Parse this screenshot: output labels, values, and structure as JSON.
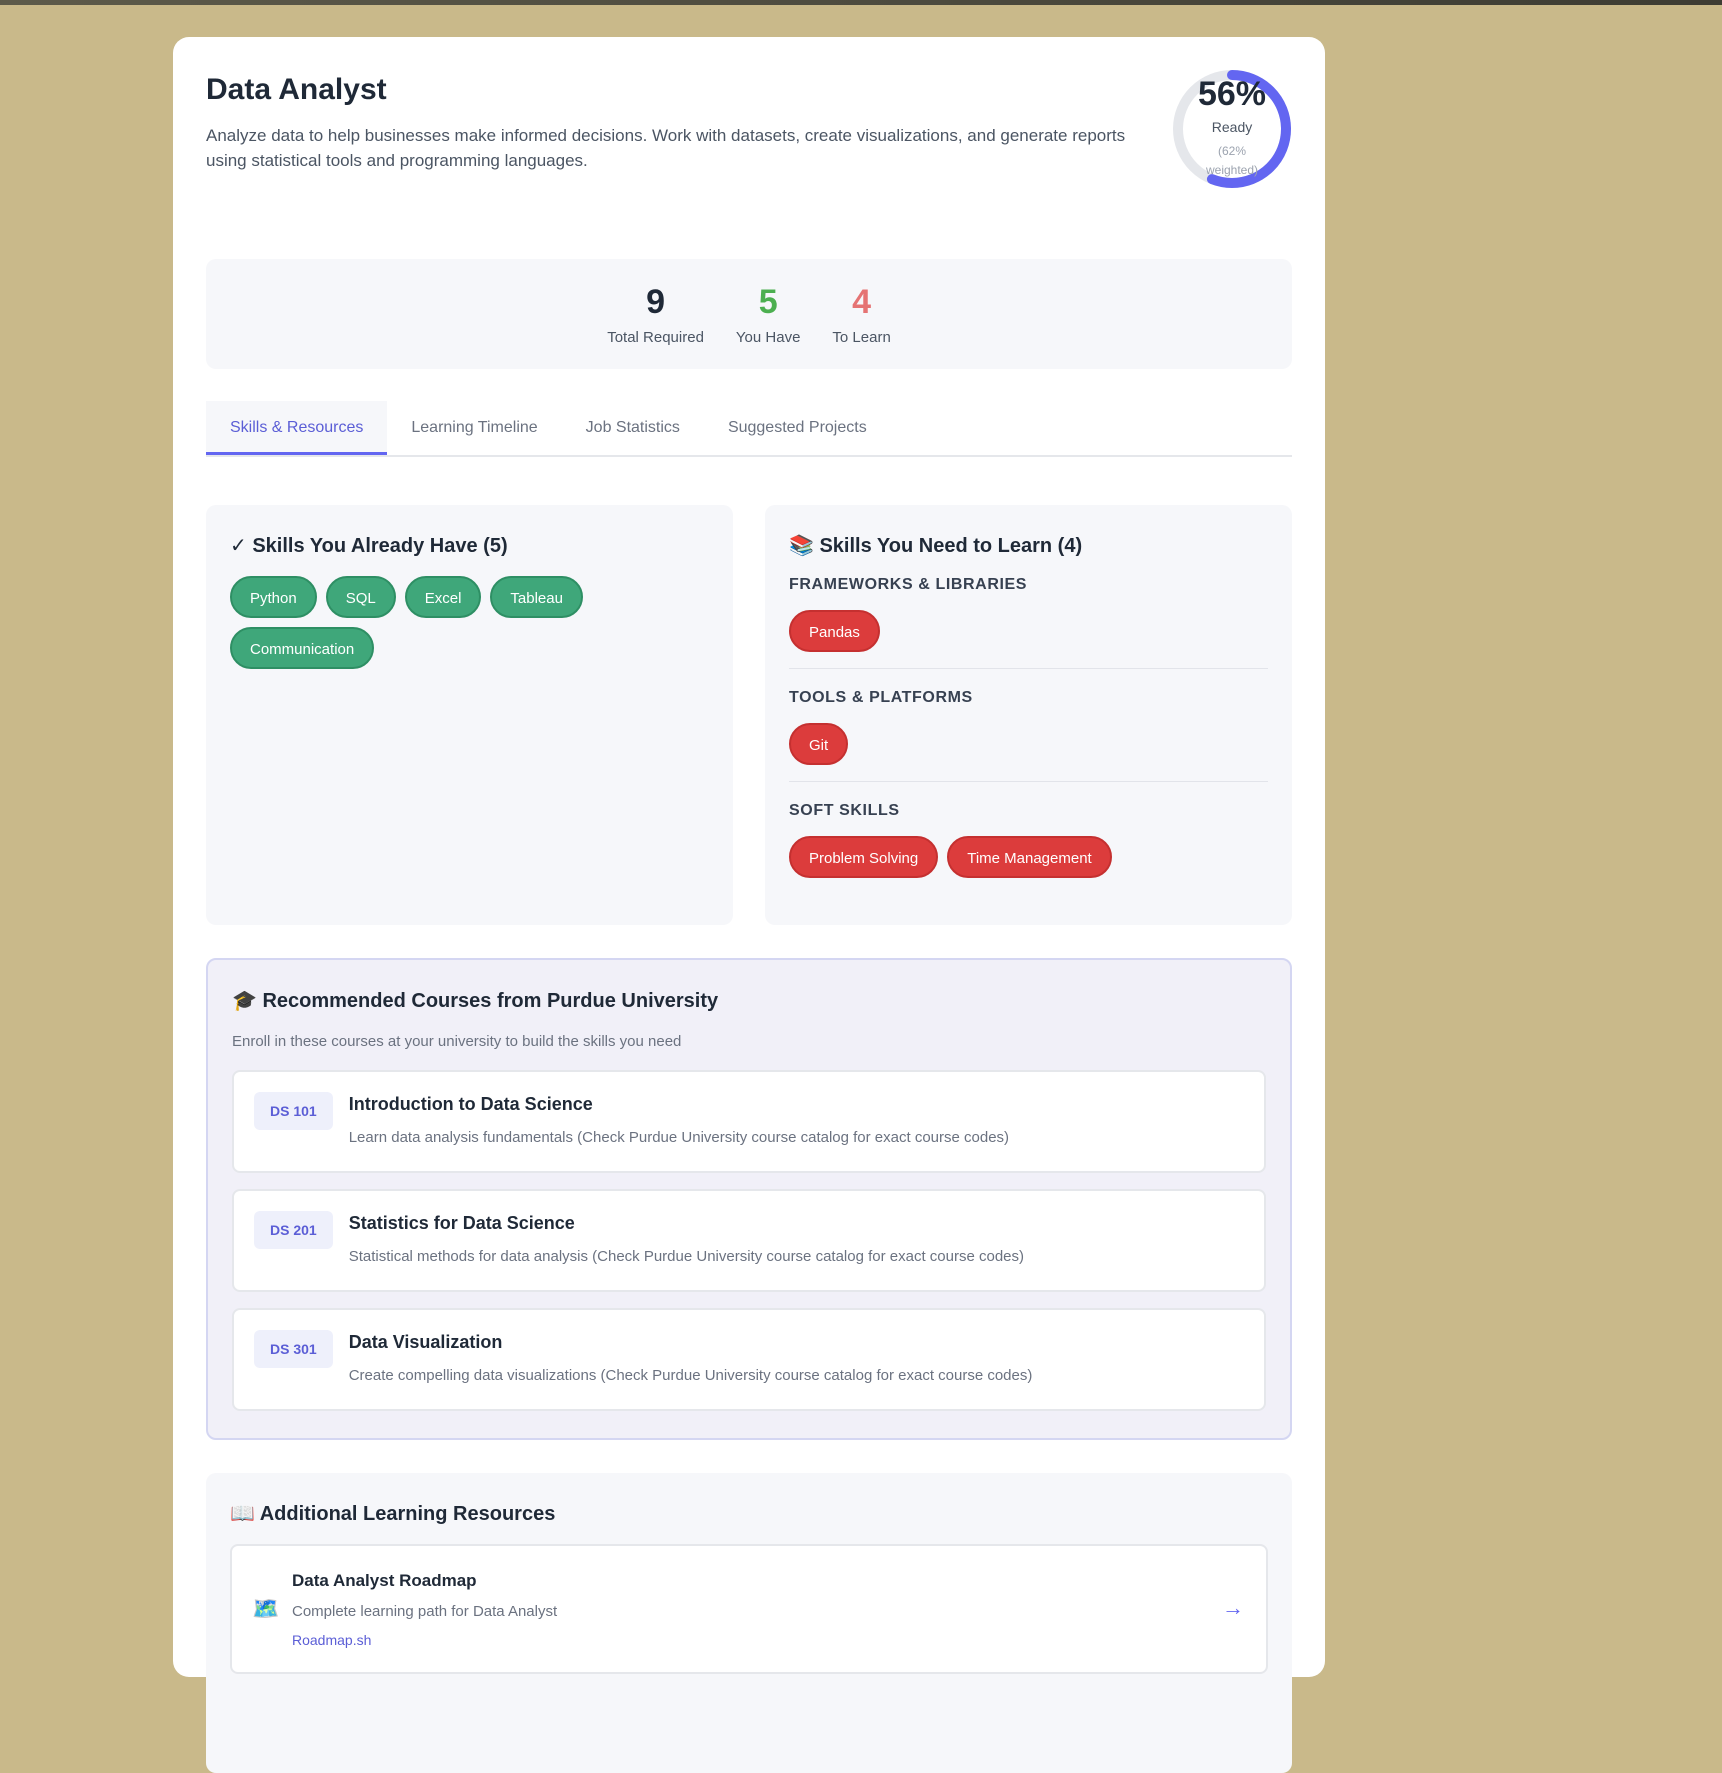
{
  "colors": {
    "accent": "#6366f1",
    "have_green": "#3fa77a",
    "learn_red": "#dc3c3c",
    "stat_total": "#1f2937",
    "stat_have": "#4caf50",
    "stat_learn": "#e57373"
  },
  "header": {
    "title": "Data Analyst",
    "description": "Analyze data to help businesses make informed decisions. Work with datasets, create visualizations, and generate reports using statistical tools and programming languages."
  },
  "readiness": {
    "percent_label": "56%",
    "percent_value": 56,
    "label": "Ready",
    "weighted": "(62% weighted)"
  },
  "stats": [
    {
      "value": "9",
      "label": "Total Required",
      "color": "#1f2937"
    },
    {
      "value": "5",
      "label": "You Have",
      "color": "#4caf50"
    },
    {
      "value": "4",
      "label": "To Learn",
      "color": "#e57373"
    }
  ],
  "tabs": [
    {
      "label": "Skills & Resources",
      "active": true
    },
    {
      "label": "Learning Timeline",
      "active": false
    },
    {
      "label": "Job Statistics",
      "active": false
    },
    {
      "label": "Suggested Projects",
      "active": false
    }
  ],
  "have_panel": {
    "icon": "check-icon",
    "title": "✓ Skills You Already Have (5)",
    "skills": [
      "Python",
      "SQL",
      "Excel",
      "Tableau",
      "Communication"
    ]
  },
  "learn_panel": {
    "icon": "books-icon",
    "title": "📚 Skills You Need to Learn (4)",
    "categories": [
      {
        "heading": "FRAMEWORKS & LIBRARIES",
        "skills": [
          "Pandas"
        ]
      },
      {
        "heading": "TOOLS & PLATFORMS",
        "skills": [
          "Git"
        ]
      },
      {
        "heading": "SOFT SKILLS",
        "skills": [
          "Problem Solving",
          "Time Management"
        ]
      }
    ]
  },
  "courses": {
    "icon": "graduation-cap-icon",
    "title": "🎓 Recommended Courses from Purdue University",
    "subtitle": "Enroll in these courses at your university to build the skills you need",
    "items": [
      {
        "code": "DS 101",
        "name": "Introduction to Data Science",
        "desc": "Learn data analysis fundamentals (Check Purdue University course catalog for exact course codes)"
      },
      {
        "code": "DS 201",
        "name": "Statistics for Data Science",
        "desc": "Statistical methods for data analysis (Check Purdue University course catalog for exact course codes)"
      },
      {
        "code": "DS 301",
        "name": "Data Visualization",
        "desc": "Create compelling data visualizations (Check Purdue University course catalog for exact course codes)"
      }
    ]
  },
  "resources": {
    "icon": "open-book-icon",
    "title": "📖 Additional Learning Resources",
    "items": [
      {
        "icon": "map-icon",
        "glyph": "🗺️",
        "name": "Data Analyst Roadmap",
        "desc": "Complete learning path for Data Analyst",
        "source": "Roadmap.sh",
        "arrow": "→"
      }
    ]
  }
}
